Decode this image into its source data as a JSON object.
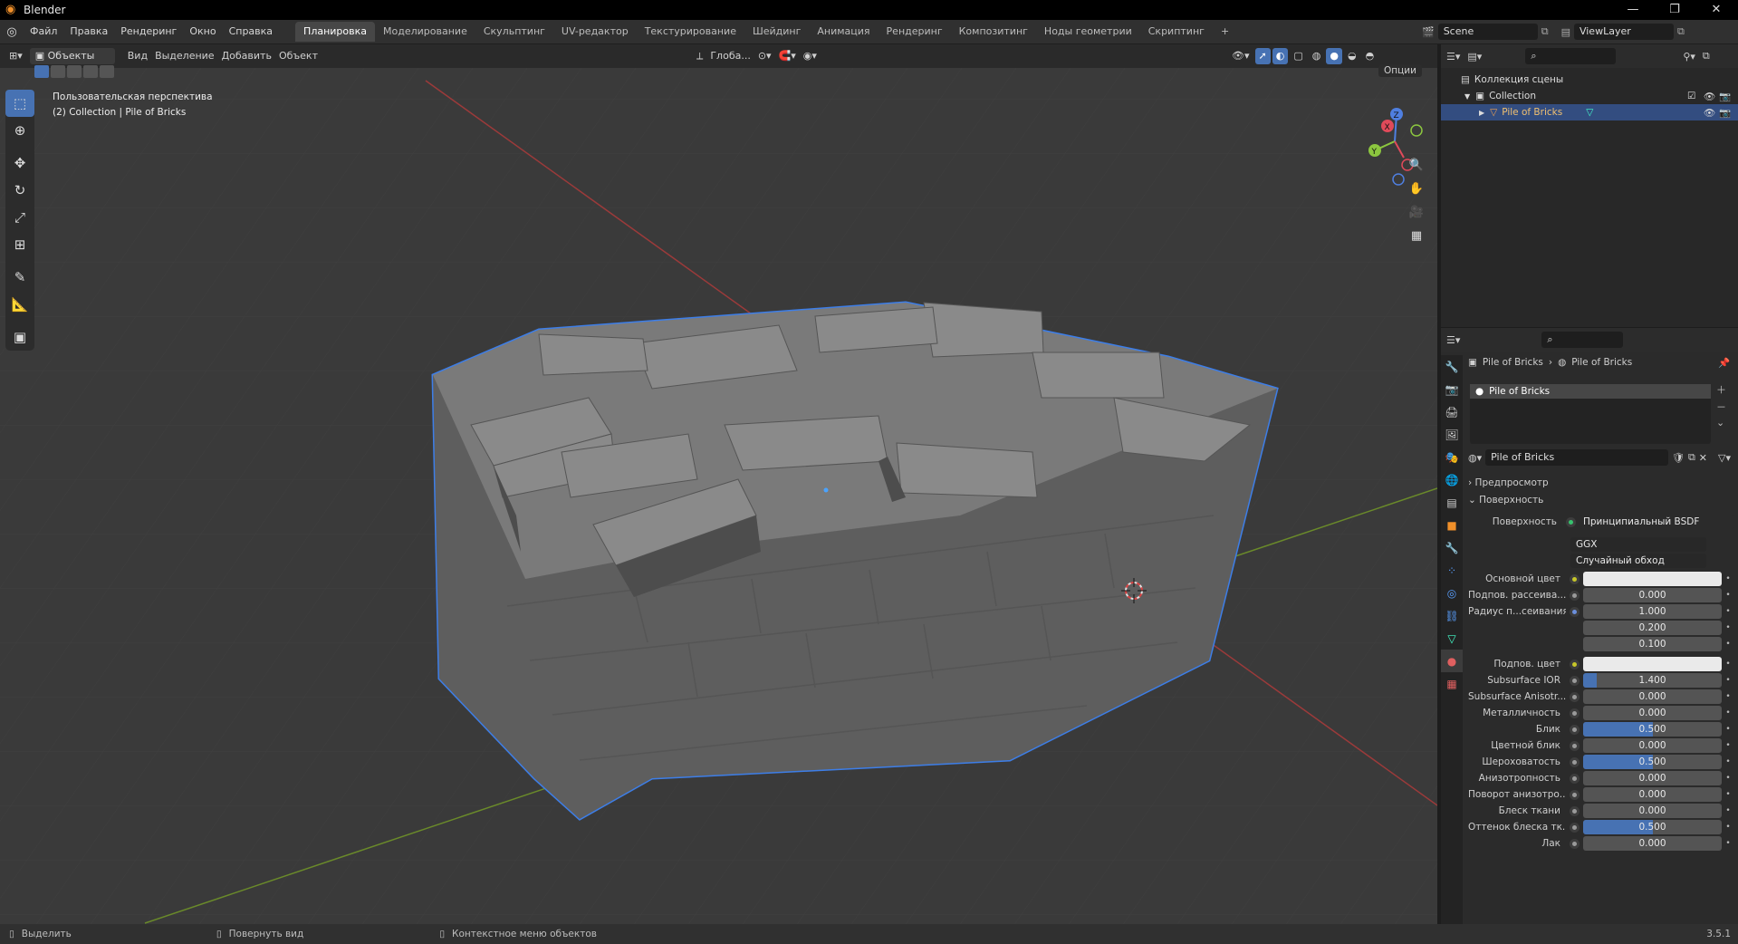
{
  "window": {
    "title": "Blender"
  },
  "topbar": {
    "menus": [
      "Файл",
      "Правка",
      "Рендеринг",
      "Окно",
      "Справка"
    ],
    "workspaces": [
      "Планировка",
      "Моделирование",
      "Скульптинг",
      "UV-редактор",
      "Текстурирование",
      "Шейдинг",
      "Анимация",
      "Рендеринг",
      "Композитинг",
      "Ноды геометрии",
      "Скриптинг"
    ],
    "active_workspace": "Планировка",
    "add_tab": "+",
    "scene": "Scene",
    "view_layer": "ViewLayer"
  },
  "viewport": {
    "mode": "Объекты",
    "menus": [
      "Вид",
      "Выделение",
      "Добавить",
      "Объект"
    ],
    "orientation": "Глоба...",
    "options": "Опции",
    "view_name": "Пользовательская перспектива",
    "collection_info": "(2) Collection | Pile of Bricks",
    "gizmo": {
      "x": "X",
      "y": "Y",
      "z": "Z"
    }
  },
  "outliner": {
    "scene_collection": "Коллекция сцены",
    "collection": "Collection",
    "object": "Pile of Bricks"
  },
  "properties": {
    "breadcrumb_object": "Pile of Bricks",
    "breadcrumb_material": "Pile of Bricks",
    "slot": "Pile of Bricks",
    "material_name": "Pile of Bricks",
    "panel_preview": "Предпросмотр",
    "panel_surface": "Поверхность",
    "surface_label": "Поверхность",
    "surface_value": "Принципиальный BSDF",
    "distribution": "GGX",
    "subsurface_method": "Случайный обход",
    "rows": [
      {
        "label": "Основной цвет",
        "type": "color",
        "color": "#eaeaea",
        "dot": "yellow"
      },
      {
        "label": "Подпов. рассеива...",
        "value": "0.000",
        "fill": 0,
        "dot": "grey"
      },
      {
        "label": "Радиус п...сеивания",
        "value": "1.000",
        "fill": 0,
        "dot": "blue"
      },
      {
        "label": "",
        "value": "0.200",
        "fill": 0,
        "dot": ""
      },
      {
        "label": "",
        "value": "0.100",
        "fill": 0,
        "dot": ""
      },
      {
        "label": "Подпов. цвет",
        "type": "color",
        "color": "#eaeaea",
        "dot": "yellow"
      },
      {
        "label": "Subsurface IOR",
        "value": "1.400",
        "fill": 0.1,
        "dot": "grey"
      },
      {
        "label": "Subsurface Anisotr...",
        "value": "0.000",
        "fill": 0,
        "dot": "grey"
      },
      {
        "label": "Металличность",
        "value": "0.000",
        "fill": 0,
        "dot": "grey"
      },
      {
        "label": "Блик",
        "value": "0.500",
        "fill": 0.5,
        "dot": "grey"
      },
      {
        "label": "Цветной блик",
        "value": "0.000",
        "fill": 0,
        "dot": "grey"
      },
      {
        "label": "Шероховатость",
        "value": "0.500",
        "fill": 0.5,
        "dot": "grey"
      },
      {
        "label": "Анизотропность",
        "value": "0.000",
        "fill": 0,
        "dot": "grey"
      },
      {
        "label": "Поворот анизотро...",
        "value": "0.000",
        "fill": 0,
        "dot": "grey"
      },
      {
        "label": "Блеск ткани",
        "value": "0.000",
        "fill": 0,
        "dot": "grey"
      },
      {
        "label": "Оттенок блеска тк...",
        "value": "0.500",
        "fill": 0.5,
        "dot": "grey"
      },
      {
        "label": "Лак",
        "value": "0.000",
        "fill": 0,
        "dot": "grey"
      }
    ]
  },
  "statusbar": {
    "select": "Выделить",
    "rotate": "Повернуть вид",
    "context": "Контекстное меню объектов",
    "version": "3.5.1"
  },
  "colors": {
    "accent": "#4772b3",
    "selection_outline": "#3d7ee8"
  }
}
